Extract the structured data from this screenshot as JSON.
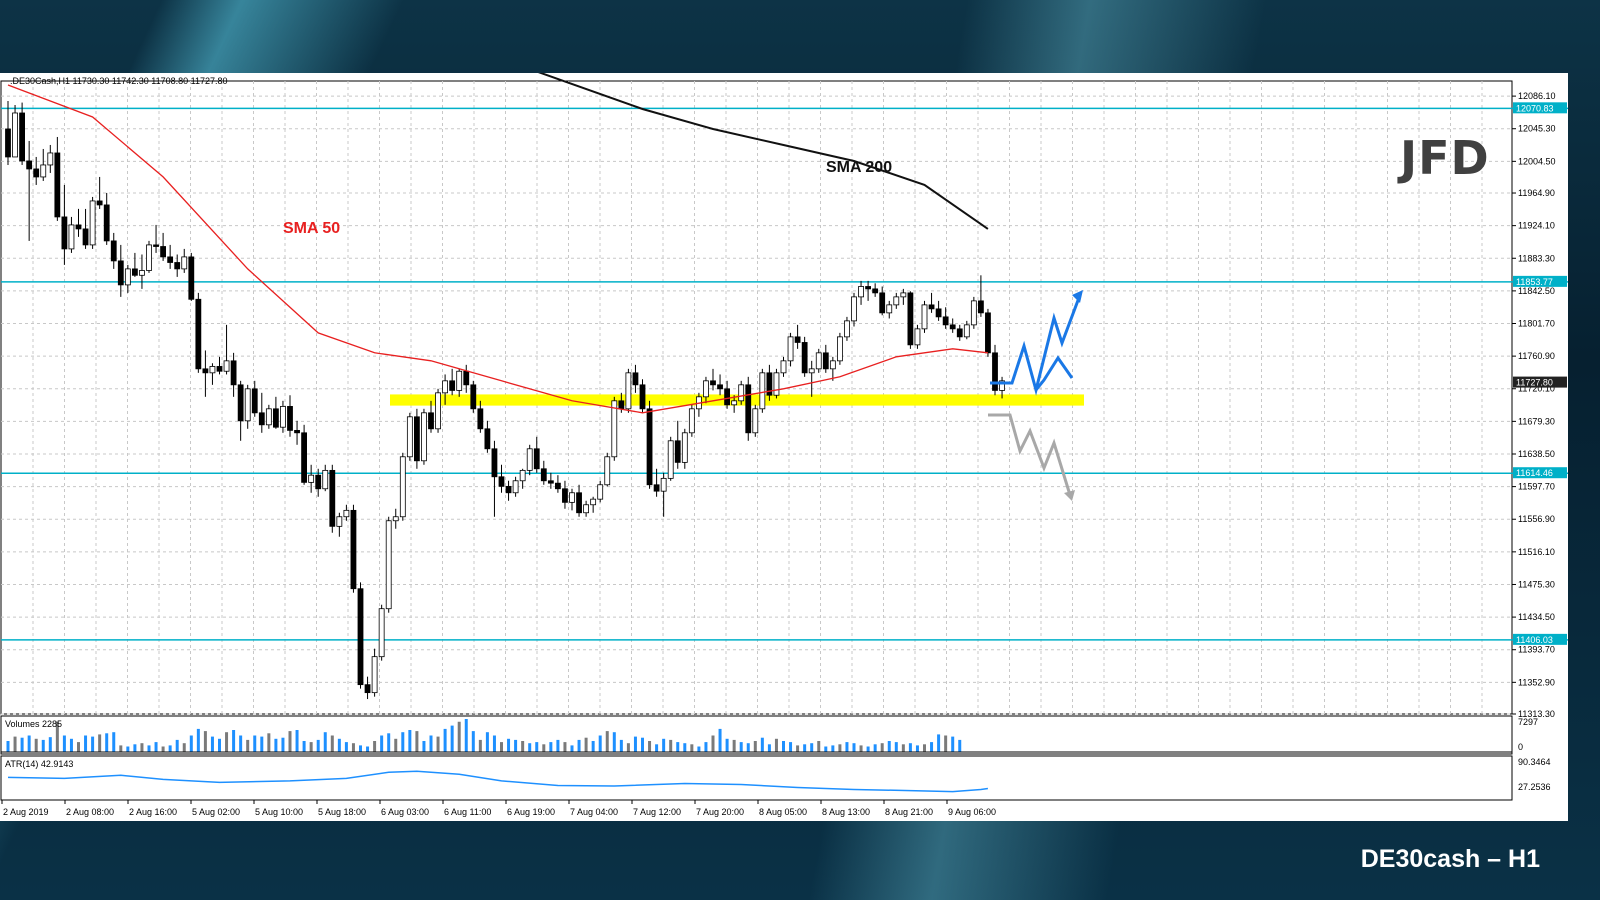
{
  "caption": "DE30cash – H1",
  "logo_text": "JFD",
  "colors": {
    "sma50": "#e82020",
    "sma200": "#111111",
    "hline": "#00b0c8",
    "zone": "#ffff00",
    "bull_path": "#1a78e6",
    "bear_path": "#a8a8a8",
    "volume": "#1e90ff",
    "atr": "#1e90ff"
  },
  "chart_data": {
    "type": "candlestick",
    "title": ".DE30Cash,H1",
    "ohlc_header": "11730.30 11742.30 11708.80 11727.80",
    "ylim": [
      11313.3,
      12100
    ],
    "y_ticks": [
      "12086.10",
      "12045.30",
      "12004.50",
      "11964.90",
      "11924.10",
      "11883.30",
      "11842.50",
      "11801.70",
      "11760.90",
      "11720.10",
      "11679.30",
      "11638.50",
      "11597.70",
      "11556.90",
      "11516.10",
      "11475.30",
      "11434.50",
      "11393.70",
      "11352.90",
      "11313.30"
    ],
    "x_ticks": [
      "2 Aug 2019",
      "2 Aug 08:00",
      "2 Aug 16:00",
      "5 Aug 02:00",
      "5 Aug 10:00",
      "5 Aug 18:00",
      "6 Aug 03:00",
      "6 Aug 11:00",
      "6 Aug 19:00",
      "7 Aug 04:00",
      "7 Aug 12:00",
      "7 Aug 20:00",
      "8 Aug 05:00",
      "8 Aug 13:00",
      "8 Aug 21:00",
      "9 Aug 06:00"
    ],
    "horizontal_levels": [
      {
        "value": 12070.83,
        "label": "12070.83"
      },
      {
        "value": 11853.77,
        "label": "11853.77"
      },
      {
        "value": 11614.46,
        "label": "11614.46"
      },
      {
        "value": 11406.03,
        "label": "11406.03"
      }
    ],
    "current_price": {
      "value": 11727.8,
      "label": "11727.80"
    },
    "support_zone": [
      11699,
      11713
    ],
    "sma_labels": {
      "sma50": "SMA 50",
      "sma200": "SMA 200"
    },
    "candles": [
      [
        12045,
        12080,
        12000,
        12010
      ],
      [
        12010,
        12075,
        12010,
        12065
      ],
      [
        12065,
        12078,
        12000,
        12005
      ],
      [
        12005,
        12030,
        11905,
        11995
      ],
      [
        11995,
        12010,
        11975,
        11985
      ],
      [
        11985,
        12020,
        11980,
        12000
      ],
      [
        12000,
        12025,
        11990,
        12015
      ],
      [
        12015,
        12035,
        11930,
        11935
      ],
      [
        11935,
        11975,
        11875,
        11895
      ],
      [
        11895,
        11935,
        11890,
        11925
      ],
      [
        11925,
        11945,
        11910,
        11920
      ],
      [
        11920,
        11945,
        11895,
        11900
      ],
      [
        11900,
        11960,
        11895,
        11955
      ],
      [
        11955,
        11985,
        11945,
        11950
      ],
      [
        11950,
        11965,
        11900,
        11905
      ],
      [
        11905,
        11915,
        11870,
        11880
      ],
      [
        11880,
        11900,
        11835,
        11850
      ],
      [
        11850,
        11875,
        11840,
        11870
      ],
      [
        11870,
        11890,
        11860,
        11862
      ],
      [
        11862,
        11888,
        11845,
        11868
      ],
      [
        11868,
        11905,
        11865,
        11900
      ],
      [
        11900,
        11925,
        11890,
        11898
      ],
      [
        11898,
        11915,
        11880,
        11885
      ],
      [
        11885,
        11900,
        11870,
        11878
      ],
      [
        11878,
        11888,
        11860,
        11870
      ],
      [
        11870,
        11895,
        11865,
        11885
      ],
      [
        11885,
        11890,
        11830,
        11832
      ],
      [
        11832,
        11840,
        11740,
        11745
      ],
      [
        11745,
        11768,
        11710,
        11740
      ],
      [
        11740,
        11752,
        11725,
        11748
      ],
      [
        11748,
        11760,
        11738,
        11742
      ],
      [
        11742,
        11800,
        11738,
        11755
      ],
      [
        11755,
        11765,
        11710,
        11725
      ],
      [
        11725,
        11730,
        11655,
        11680
      ],
      [
        11680,
        11725,
        11670,
        11720
      ],
      [
        11720,
        11730,
        11685,
        11690
      ],
      [
        11690,
        11715,
        11665,
        11675
      ],
      [
        11675,
        11700,
        11670,
        11695
      ],
      [
        11695,
        11710,
        11670,
        11672
      ],
      [
        11672,
        11705,
        11665,
        11698
      ],
      [
        11698,
        11712,
        11660,
        11668
      ],
      [
        11668,
        11680,
        11650,
        11665
      ],
      [
        11665,
        11675,
        11600,
        11603
      ],
      [
        11603,
        11625,
        11590,
        11612
      ],
      [
        11612,
        11620,
        11585,
        11595
      ],
      [
        11595,
        11625,
        11592,
        11618
      ],
      [
        11618,
        11625,
        11540,
        11548
      ],
      [
        11548,
        11565,
        11535,
        11560
      ],
      [
        11560,
        11575,
        11555,
        11568
      ],
      [
        11568,
        11575,
        11465,
        11470
      ],
      [
        11470,
        11478,
        11345,
        11350
      ],
      [
        11350,
        11360,
        11332,
        11340
      ],
      [
        11340,
        11395,
        11335,
        11385
      ],
      [
        11385,
        11450,
        11380,
        11445
      ],
      [
        11445,
        11560,
        11440,
        11555
      ],
      [
        11555,
        11570,
        11545,
        11560
      ],
      [
        11560,
        11640,
        11555,
        11635
      ],
      [
        11635,
        11690,
        11630,
        11685
      ],
      [
        11685,
        11695,
        11620,
        11630
      ],
      [
        11630,
        11695,
        11625,
        11690
      ],
      [
        11690,
        11705,
        11665,
        11670
      ],
      [
        11670,
        11720,
        11665,
        11715
      ],
      [
        11715,
        11738,
        11700,
        11730
      ],
      [
        11730,
        11745,
        11712,
        11718
      ],
      [
        11718,
        11745,
        11710,
        11742
      ],
      [
        11742,
        11750,
        11715,
        11725
      ],
      [
        11725,
        11730,
        11690,
        11695
      ],
      [
        11695,
        11705,
        11665,
        11670
      ],
      [
        11670,
        11680,
        11640,
        11645
      ],
      [
        11645,
        11655,
        11560,
        11610
      ],
      [
        11610,
        11625,
        11590,
        11598
      ],
      [
        11598,
        11605,
        11580,
        11590
      ],
      [
        11590,
        11610,
        11585,
        11605
      ],
      [
        11605,
        11620,
        11595,
        11618
      ],
      [
        11618,
        11650,
        11612,
        11645
      ],
      [
        11645,
        11660,
        11615,
        11620
      ],
      [
        11620,
        11630,
        11600,
        11605
      ],
      [
        11605,
        11615,
        11595,
        11602
      ],
      [
        11602,
        11612,
        11590,
        11595
      ],
      [
        11595,
        11605,
        11570,
        11578
      ],
      [
        11578,
        11595,
        11568,
        11590
      ],
      [
        11590,
        11600,
        11560,
        11565
      ],
      [
        11565,
        11580,
        11560,
        11575
      ],
      [
        11575,
        11585,
        11565,
        11582
      ],
      [
        11582,
        11605,
        11578,
        11600
      ],
      [
        11600,
        11640,
        11598,
        11635
      ],
      [
        11635,
        11710,
        11630,
        11705
      ],
      [
        11705,
        11715,
        11690,
        11695
      ],
      [
        11695,
        11745,
        11690,
        11740
      ],
      [
        11740,
        11750,
        11715,
        11725
      ],
      [
        11725,
        11732,
        11690,
        11695
      ],
      [
        11695,
        11705,
        11595,
        11600
      ],
      [
        11600,
        11620,
        11585,
        11592
      ],
      [
        11592,
        11615,
        11560,
        11608
      ],
      [
        11608,
        11660,
        11605,
        11655
      ],
      [
        11655,
        11680,
        11620,
        11628
      ],
      [
        11628,
        11670,
        11620,
        11665
      ],
      [
        11665,
        11700,
        11660,
        11695
      ],
      [
        11695,
        11715,
        11685,
        11710
      ],
      [
        11710,
        11735,
        11702,
        11730
      ],
      [
        11730,
        11745,
        11718,
        11725
      ],
      [
        11725,
        11738,
        11712,
        11720
      ],
      [
        11720,
        11730,
        11695,
        11700
      ],
      [
        11700,
        11712,
        11690,
        11705
      ],
      [
        11705,
        11730,
        11700,
        11725
      ],
      [
        11725,
        11735,
        11655,
        11665
      ],
      [
        11665,
        11700,
        11660,
        11695
      ],
      [
        11695,
        11745,
        11690,
        11740
      ],
      [
        11740,
        11750,
        11705,
        11712
      ],
      [
        11712,
        11745,
        11708,
        11740
      ],
      [
        11740,
        11760,
        11735,
        11755
      ],
      [
        11755,
        11790,
        11748,
        11785
      ],
      [
        11785,
        11800,
        11770,
        11778
      ],
      [
        11778,
        11785,
        11735,
        11740
      ],
      [
        11740,
        11755,
        11710,
        11745
      ],
      [
        11745,
        11770,
        11740,
        11765
      ],
      [
        11765,
        11775,
        11740,
        11745
      ],
      [
        11745,
        11760,
        11730,
        11755
      ],
      [
        11755,
        11790,
        11750,
        11785
      ],
      [
        11785,
        11810,
        11780,
        11805
      ],
      [
        11805,
        11840,
        11798,
        11835
      ],
      [
        11835,
        11855,
        11825,
        11848
      ],
      [
        11848,
        11855,
        11830,
        11845
      ],
      [
        11845,
        11852,
        11835,
        11840
      ],
      [
        11840,
        11848,
        11812,
        11815
      ],
      [
        11815,
        11830,
        11808,
        11825
      ],
      [
        11825,
        11840,
        11820,
        11835
      ],
      [
        11835,
        11845,
        11825,
        11840
      ],
      [
        11840,
        11842,
        11770,
        11775
      ],
      [
        11775,
        11800,
        11770,
        11795
      ],
      [
        11795,
        11830,
        11790,
        11825
      ],
      [
        11825,
        11840,
        11815,
        11820
      ],
      [
        11820,
        11830,
        11805,
        11810
      ],
      [
        11810,
        11822,
        11795,
        11800
      ],
      [
        11800,
        11808,
        11790,
        11795
      ],
      [
        11795,
        11800,
        11780,
        11785
      ],
      [
        11785,
        11805,
        11782,
        11800
      ],
      [
        11800,
        11835,
        11795,
        11830
      ],
      [
        11830,
        11862,
        11810,
        11815
      ],
      [
        11815,
        11820,
        11760,
        11765
      ],
      [
        11765,
        11775,
        11712,
        11718
      ],
      [
        11718,
        11735,
        11708,
        11730
      ]
    ],
    "sma50": [
      [
        0,
        12100
      ],
      [
        12,
        12060
      ],
      [
        22,
        11985
      ],
      [
        34,
        11870
      ],
      [
        44,
        11790
      ],
      [
        52,
        11765
      ],
      [
        60,
        11755
      ],
      [
        70,
        11730
      ],
      [
        80,
        11705
      ],
      [
        90,
        11690
      ],
      [
        100,
        11705
      ],
      [
        110,
        11720
      ],
      [
        118,
        11735
      ],
      [
        126,
        11760
      ],
      [
        134,
        11770
      ],
      [
        139,
        11765
      ]
    ],
    "sma200": [
      [
        74,
        12120
      ],
      [
        90,
        12070
      ],
      [
        100,
        12045
      ],
      [
        110,
        12025
      ],
      [
        120,
        12005
      ],
      [
        130,
        11975
      ],
      [
        139,
        11920
      ]
    ],
    "volume_label": "Volumes 2285",
    "volume_ticks": [
      "7297",
      "0"
    ],
    "volumes": [
      20,
      28,
      26,
      30,
      24,
      22,
      27,
      55,
      30,
      24,
      18,
      30,
      28,
      32,
      34,
      36,
      12,
      10,
      14,
      16,
      12,
      18,
      10,
      12,
      22,
      16,
      30,
      42,
      38,
      28,
      24,
      36,
      40,
      30,
      22,
      30,
      28,
      34,
      24,
      26,
      38,
      40,
      20,
      18,
      22,
      36,
      30,
      24,
      18,
      16,
      12,
      10,
      20,
      30,
      34,
      24,
      36,
      40,
      38,
      20,
      30,
      28,
      42,
      48,
      55,
      60,
      38,
      22,
      36,
      30,
      18,
      24,
      22,
      20,
      16,
      18,
      14,
      18,
      22,
      18,
      12,
      22,
      26,
      20,
      30,
      38,
      36,
      22,
      16,
      28,
      26,
      20,
      14,
      24,
      22,
      18,
      16,
      14,
      10,
      18,
      30,
      42,
      24,
      22,
      18,
      16,
      20,
      26,
      14,
      24,
      20,
      18,
      12,
      14,
      16,
      20,
      10,
      12,
      14,
      18,
      16,
      12,
      10,
      14,
      16,
      20,
      18,
      14,
      16,
      12,
      14,
      18,
      32,
      30,
      28,
      22
    ],
    "atr_label": "ATR(14) 42.9143",
    "atr_ticks": [
      "90.3464",
      "27.2536"
    ],
    "atr": [
      [
        0,
        62
      ],
      [
        8,
        60
      ],
      [
        16,
        66
      ],
      [
        22,
        58
      ],
      [
        30,
        52
      ],
      [
        40,
        55
      ],
      [
        48,
        60
      ],
      [
        54,
        72
      ],
      [
        58,
        74
      ],
      [
        64,
        68
      ],
      [
        70,
        55
      ],
      [
        78,
        46
      ],
      [
        86,
        45
      ],
      [
        96,
        50
      ],
      [
        104,
        48
      ],
      [
        112,
        42
      ],
      [
        120,
        38
      ],
      [
        128,
        36
      ],
      [
        134,
        34
      ],
      [
        138,
        38
      ],
      [
        139,
        40
      ]
    ]
  }
}
